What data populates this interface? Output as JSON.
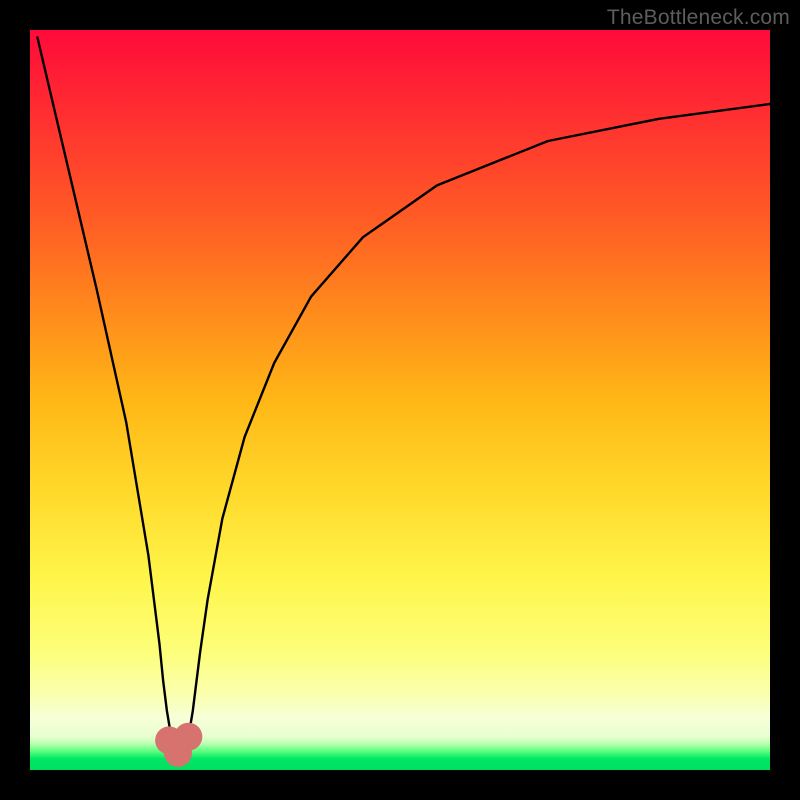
{
  "watermark": {
    "text": "TheBottleneck.com"
  },
  "chart_data": {
    "type": "line",
    "title": "",
    "xlabel": "",
    "ylabel": "",
    "xlim": [
      0,
      100
    ],
    "ylim": [
      0,
      100
    ],
    "grid": false,
    "legend": false,
    "series": [
      {
        "name": "bottleneck-curve",
        "x": [
          1,
          5,
          9,
          13,
          16,
          17.5,
          18,
          18.5,
          19,
          19.5,
          20,
          20.5,
          21,
          21.5,
          22.0,
          22.5,
          23.0,
          24,
          26,
          29,
          33,
          38,
          45,
          55,
          70,
          85,
          100
        ],
        "values": [
          99,
          82,
          65,
          47,
          29,
          17,
          12,
          8,
          5,
          3.0,
          2.3,
          2.4,
          3,
          5,
          8,
          12,
          16,
          23,
          34,
          45,
          55,
          64,
          72,
          79,
          85,
          88,
          90
        ]
      }
    ],
    "markers": [
      {
        "name": "marker-low",
        "x": 18.8,
        "y": 4.0,
        "size": 14,
        "color": "#d6736e"
      },
      {
        "name": "marker-dip",
        "x": 20.0,
        "y": 2.3,
        "size": 14,
        "color": "#d6736e"
      },
      {
        "name": "marker-high",
        "x": 21.4,
        "y": 4.5,
        "size": 14,
        "color": "#d6736e"
      }
    ],
    "background_gradient": {
      "top": "#ff0a3a",
      "mid": "#ffd82a",
      "bottom": "#00e060"
    }
  }
}
